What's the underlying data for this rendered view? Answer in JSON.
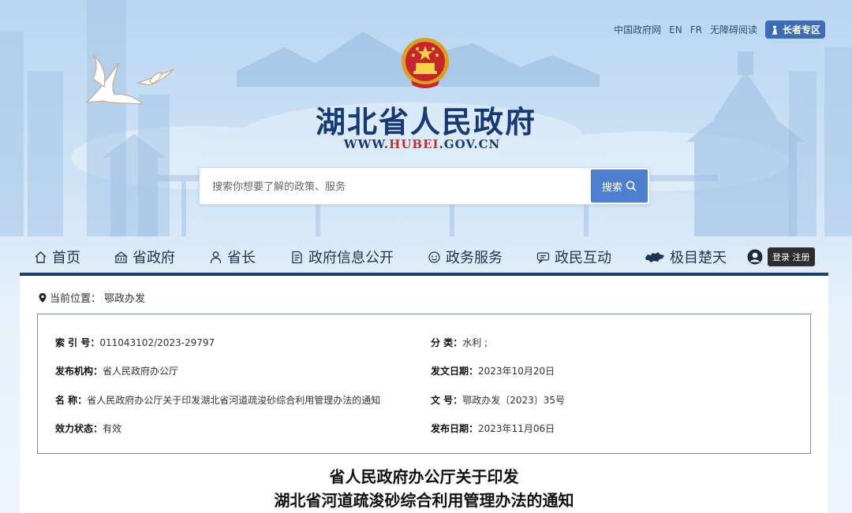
{
  "top_links": {
    "gov": "中国政府网",
    "en": "EN",
    "fr": "FR",
    "accessible": "无障碍阅读",
    "elder": "长者专区"
  },
  "header": {
    "title": "湖北省人民政府",
    "url_prefix": "WWW.",
    "url_highlight": "HUBEI",
    "url_suffix": ".GOV.CN"
  },
  "search": {
    "placeholder": "搜索你想要了解的政策、服务",
    "button_label": "搜索"
  },
  "nav": {
    "items": [
      {
        "label": "首页",
        "icon": "home-icon"
      },
      {
        "label": "省政府",
        "icon": "building-icon"
      },
      {
        "label": "省长",
        "icon": "person-icon"
      },
      {
        "label": "政府信息公开",
        "icon": "document-icon"
      },
      {
        "label": "政务服务",
        "icon": "service-icon"
      },
      {
        "label": "政民互动",
        "icon": "chat-icon"
      },
      {
        "label": "极目楚天",
        "icon": "hubei-map-icon"
      }
    ],
    "login_label": "登录 注册"
  },
  "breadcrumb": {
    "prefix": "当前位置：",
    "current": "鄂政办发"
  },
  "meta": {
    "index_label": "索  引  号：",
    "index_value": "011043102/2023-29797",
    "category_label": "分  类：",
    "category_value": "水利   ;",
    "publisher_label": "发布机构：",
    "publisher_value": "省人民政府办公厅",
    "issue_date_label": "发文日期：",
    "issue_date_value": "2023年10月20日",
    "name_label": "名  称：",
    "name_value": "省人民政府办公厅关于印发湖北省河道疏浚砂综合利用管理办法的通知",
    "doc_no_label": "文  号：",
    "doc_no_value": "鄂政办发〔2023〕35号",
    "status_label": "效力状态：",
    "status_value": "有效",
    "publish_date_label": "发布日期：",
    "publish_date_value": "2023年11月06日"
  },
  "document": {
    "title_line1": "省人民政府办公厅关于印发",
    "title_line2": "湖北省河道疏浚砂综合利用管理办法的通知"
  },
  "colors": {
    "brand_navy": "#163a78",
    "accent_red": "#c82e2e",
    "button_blue": "#4d7fd0",
    "nav_bar": "#1a3d78"
  }
}
